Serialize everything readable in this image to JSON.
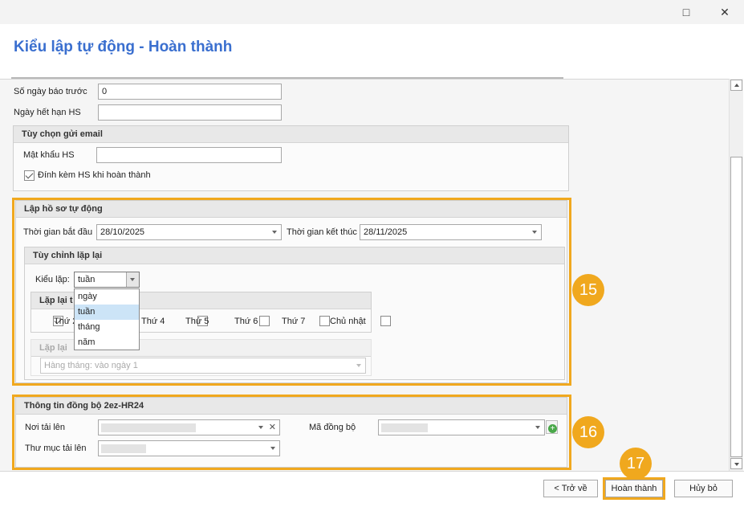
{
  "window": {
    "maximize_icon": "□",
    "close_icon": "✕"
  },
  "header": {
    "title": "Kiểu lập tự động - Hoàn thành"
  },
  "form": {
    "notice_days_label": "Số ngày báo trước",
    "notice_days_value": "0",
    "expiry_label": "Ngày hết hạn HS",
    "expiry_value": ""
  },
  "email": {
    "title": "Tùy chọn gửi email",
    "password_label": "Mật khẩu HS",
    "attach_label": "Đính kèm HS khi hoàn thành",
    "attach_checked": true
  },
  "auto": {
    "title": "Lập hồ sơ tự động",
    "start_label": "Thời gian bắt đầu",
    "start_value": "28/10/2025",
    "end_label": "Thời gian kết thúc",
    "end_value": "28/11/2025",
    "repeat": {
      "title": "Tùy chỉnh lặp lại",
      "type_label": "Kiểu lặp:",
      "type_value": "tuần",
      "options": [
        "ngày",
        "tuần",
        "tháng",
        "năm"
      ],
      "weekly_title_visible": "Lặp lại t",
      "days": [
        {
          "label": "Thứ 2",
          "checked": true
        },
        {
          "label": "Thứ 4",
          "checked": false
        },
        {
          "label": "Thứ 5",
          "checked": false
        },
        {
          "label": "Thứ 6",
          "checked": false
        },
        {
          "label": "Thứ 7",
          "checked": false
        },
        {
          "label": "Chủ nhật",
          "checked": false
        }
      ],
      "monthly_title_visible": "Lặp lại",
      "monthly_value": "Hàng tháng: vào ngày 1"
    }
  },
  "sync": {
    "title": "Thông tin đồng bộ 2ez-HR24",
    "upload_label": "Nơi tải lên",
    "folder_label": "Thư mục tải lên",
    "code_label": "Mã đồng bộ",
    "clear_icon": "✕"
  },
  "badges": {
    "b15": "15",
    "b16": "16",
    "b17": "17"
  },
  "footer": {
    "back_label": "< Trở về",
    "finish_label": "Hoàn thành",
    "cancel_label": "Hủy bỏ"
  },
  "colors": {
    "accent": "#f0a81e",
    "title": "#3a6fcf"
  }
}
